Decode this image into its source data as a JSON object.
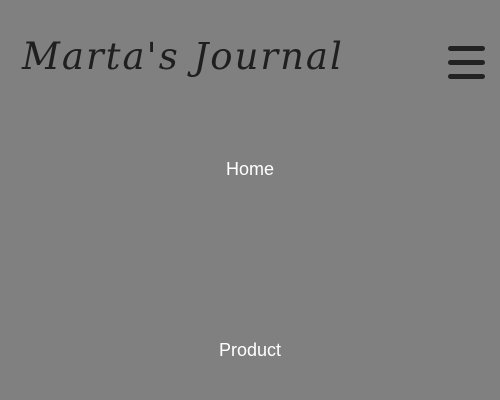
{
  "header": {
    "brand": "Marta's Journal",
    "menu_icon": "hamburger-menu-icon"
  },
  "nav": {
    "home_label": "Home",
    "product_label": "Product"
  },
  "colors": {
    "background": "#808080",
    "brand_text": "#1f1f1f",
    "menu_icon": "#222222",
    "nav_text": "#ffffff"
  }
}
